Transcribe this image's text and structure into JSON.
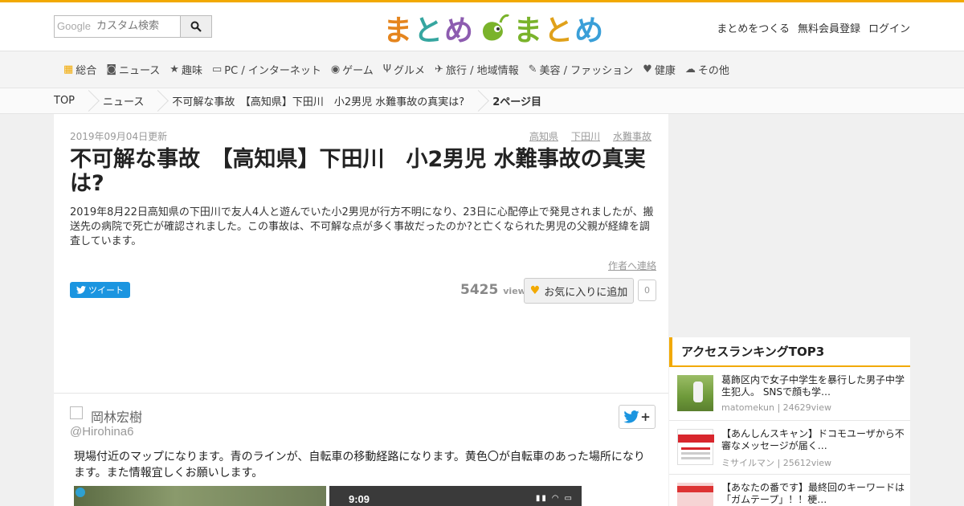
{
  "header": {
    "search_label": "Google",
    "search_placeholder": "カスタム検索",
    "logo_chars": [
      "ま",
      "と",
      "め",
      "ま",
      "と",
      "め"
    ],
    "links": [
      "まとめをつくる",
      "無料会員登録",
      "ログイン"
    ],
    "accent_color": "#f2a900"
  },
  "catnav": [
    {
      "icon": "grid-icon",
      "label": "総合"
    },
    {
      "icon": "camera-icon",
      "label": "ニュース"
    },
    {
      "icon": "star-icon",
      "label": "趣味"
    },
    {
      "icon": "monitor-icon",
      "label": "PC / インターネット"
    },
    {
      "icon": "gamepad-icon",
      "label": "ゲーム"
    },
    {
      "icon": "cutlery-icon",
      "label": "グルメ"
    },
    {
      "icon": "plane-icon",
      "label": "旅行 / 地域情報"
    },
    {
      "icon": "brush-icon",
      "label": "美容 / ファッション"
    },
    {
      "icon": "heartbeat-icon",
      "label": "健康"
    },
    {
      "icon": "other-icon",
      "label": "その他"
    }
  ],
  "breadcrumb": [
    "TOP",
    "ニュース",
    "不可解な事故　【高知県】下田川　小2男児 水難事故の真実は?",
    "2ページ目"
  ],
  "article": {
    "updated": "2019年09月04日更新",
    "tags": [
      "高知県",
      "下田川",
      "水難事故"
    ],
    "title": "不可解な事故　【高知県】下田川　小2男児 水難事故の真実は?",
    "description": "2019年8月22日高知県の下田川で友人4人と遊んでいた小2男児が行方不明になり、23日に心配停止で発見されましたが、搬送先の病院で死亡が確認されました。この事故は、不可解な点が多く事故だったのか?と亡くなられた男児の父親が経緯を調査しています。",
    "contact": "作者へ連絡",
    "tweet_label": "ツイート",
    "view_count": "5425",
    "view_unit": "view",
    "fav_label": "お気に入りに追加",
    "fav_count": "0"
  },
  "quote": {
    "author_name": "岡林宏樹",
    "author_handle": "@Hirohina6",
    "follow_label": "+",
    "text": "現場付近のマップになります。青のラインが、自転車の移動経路になります。黄色〇が自転車のあった場所になります。また情報宜しくお願いします。",
    "photo2_time": "9:09"
  },
  "ranking": {
    "heading": "アクセスランキングTOP3",
    "items": [
      {
        "title": "葛飾区内で女子中学生を暴行した男子中学生犯人。 SNSで顔も学…",
        "meta": "matomekun | 24629view"
      },
      {
        "title": "【あんしんスキャン】ドコモユーザから不審なメッセージが届く…",
        "meta": "ミサイルマン | 25612view"
      },
      {
        "title": "【あなたの番です】最終回のキーワードは「ガムテープ」！！梗…",
        "meta": ""
      }
    ]
  }
}
